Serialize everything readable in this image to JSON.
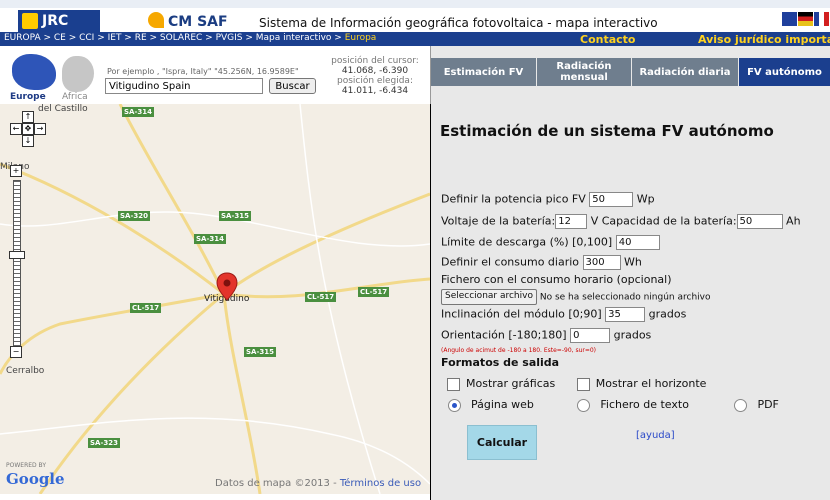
{
  "header": {
    "jrc": "JRC",
    "cmsaf": "CM SAF",
    "title": "Sistema de Información geográfica fotovoltaica - mapa interactivo",
    "flag_colors": [
      "#1f3f9c",
      "#000000",
      "#2e8b3a",
      "#e8c21a",
      "#d21f1f"
    ]
  },
  "nav": {
    "breadcrumb": "EUROPA > CE > CCI > IET > RE > SOLAREC > PVGIS > Mapa interactivo > ",
    "breadcrumb_current": "Europa",
    "contacto": "Contacto",
    "aviso": "Aviso jurídico important"
  },
  "search": {
    "region_europe": "Europe",
    "region_africa": "Africa",
    "hint": "Por ejemplo , \"Ispra, Italy\" \"45.256N, 16.9589E\"",
    "value": "Vitigudino Spain",
    "button": "Buscar",
    "cursor_label": "posición del cursor:",
    "cursor_value": "41.068, -6.390",
    "chosen_label": "posición elegida:",
    "chosen_value": "41.011, -6.434"
  },
  "map": {
    "town_marker": "Vitigudino",
    "labels": [
      "SA-314",
      "SA-320",
      "SA-315",
      "SA-314",
      "CL-517",
      "CL-517",
      "CL-517",
      "SA-315",
      "SA-323"
    ],
    "towns": [
      "Milano",
      "Cerralbo",
      "del Castillo"
    ],
    "powered": "POWERED BY",
    "google": "Google",
    "attribution": "Datos de mapa ©2013 - ",
    "terms": "Términos de uso"
  },
  "tabs": [
    {
      "label": "Estimación FV",
      "active": false
    },
    {
      "label": "Radiación mensual",
      "active": false
    },
    {
      "label": "Radiación diaria",
      "active": false
    },
    {
      "label": "FV autónomo",
      "active": true
    }
  ],
  "form": {
    "title": "Estimación de un sistema FV autónomo",
    "peak_label": "Definir la potencia pico FV",
    "peak_value": "50",
    "peak_unit": "Wp",
    "voltage_label": "Voltaje de la batería:",
    "voltage_value": "12",
    "capacity_label": "V Capacidad de la batería:",
    "capacity_value": "50",
    "capacity_unit": "Ah",
    "discharge_label": "Límite de descarga (%) [0,100]",
    "discharge_value": "40",
    "daily_label": "Definir el consumo diario",
    "daily_value": "300",
    "daily_unit": "Wh",
    "file_label": "Fichero con el consumo horario (opcional)",
    "file_button": "Seleccionar archivo",
    "file_status": "No se ha seleccionado ningún archivo",
    "incl_label": "Inclinación del módulo [0;90]",
    "incl_value": "35",
    "incl_unit": "grados",
    "orient_label": "Orientación [-180;180]",
    "orient_value": "0",
    "orient_unit": "grados",
    "orient_note": "(Angulo de acimut de -180 a 180. Este=-90, sur=0)",
    "formats_title": "Formatos de salida",
    "show_charts": "Mostrar gráficas",
    "show_horizon": "Mostrar el horizonte",
    "out_web": "Página web",
    "out_text": "Fichero de texto",
    "out_pdf": "PDF",
    "calc": "Calcular",
    "help": "[ayuda]"
  }
}
